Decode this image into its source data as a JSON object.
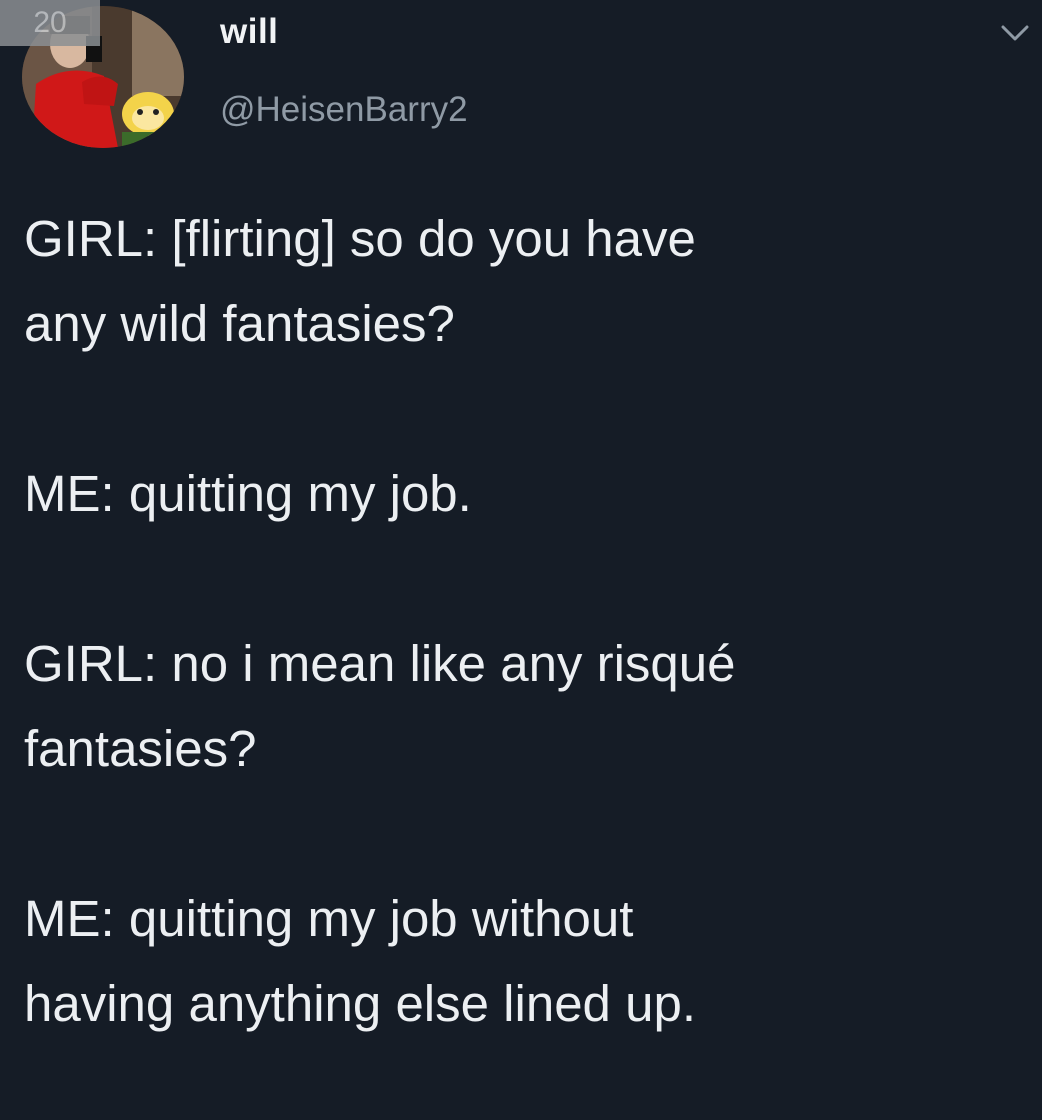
{
  "badge": {
    "text": "20"
  },
  "author": {
    "display_name": "will",
    "handle": "@HeisenBarry2"
  },
  "icons": {
    "avatar": "profile-photo",
    "menu": "chevron-down-icon"
  },
  "tweet": {
    "lines": [
      "GIRL: [flirting] so do you have",
      "any wild fantasies?",
      "ME: quitting my job.",
      "GIRL: no i mean like any risqué",
      "fantasies?",
      "ME: quitting my job without",
      "having anything else lined up."
    ]
  },
  "colors": {
    "background": "#151c26",
    "text": "#eceff2",
    "handle": "#8f9aa5"
  }
}
